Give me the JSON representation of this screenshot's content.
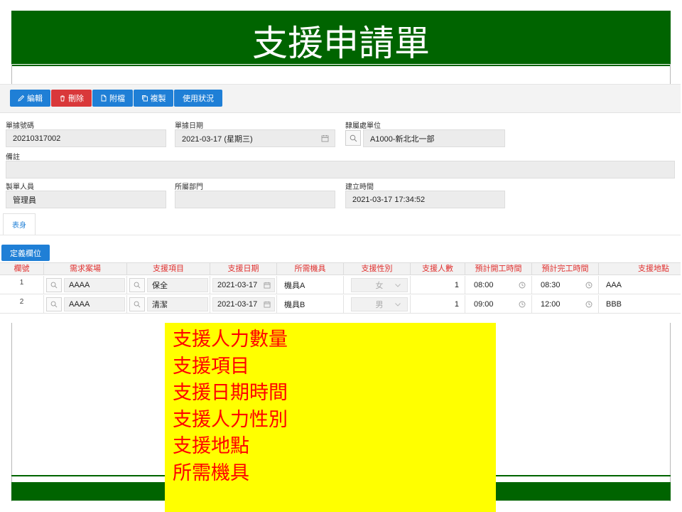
{
  "slide": {
    "title": "支援申請單"
  },
  "toolbar": {
    "buttons": [
      {
        "label": "編輯",
        "icon": "pencil-icon",
        "color": "#1f7fd6"
      },
      {
        "label": "刪除",
        "icon": "trash-icon",
        "color": "#d9383a"
      },
      {
        "label": "附檔",
        "icon": "file-icon",
        "color": "#1f7fd6"
      },
      {
        "label": "複製",
        "icon": "copy-icon",
        "color": "#1f7fd6"
      },
      {
        "label": "使用狀況",
        "icon": "",
        "color": "#1f7fd6"
      }
    ]
  },
  "form": {
    "doc_no": {
      "label": "單據號碼",
      "value": "20210317002"
    },
    "doc_date": {
      "label": "單據日期",
      "value": "2021-03-17 (星期三)"
    },
    "unit": {
      "label": "隸屬處單位",
      "value": "A1000-新北北一部"
    },
    "note": {
      "label": "備註",
      "value": ""
    },
    "creator": {
      "label": "製單人員",
      "value": "管理員"
    },
    "dept": {
      "label": "所屬部門",
      "value": ""
    },
    "created_at": {
      "label": "建立時間",
      "value": "2021-03-17 17:34:52"
    }
  },
  "tabs": {
    "body": "表身"
  },
  "grid": {
    "define_columns_label": "定義欄位",
    "headers": [
      "欄號",
      "需求案場",
      "支援項目",
      "支援日期",
      "所需機具",
      "支援性別",
      "支援人數",
      "預計開工時間",
      "預計完工時間",
      "支援地點"
    ],
    "rows": [
      {
        "no": "1",
        "site": "AAAA",
        "item": "保全",
        "date": "2021-03-17",
        "tool": "機具A",
        "gender": "女",
        "count": "1",
        "start": "08:00",
        "end": "08:30",
        "place": "AAA"
      },
      {
        "no": "2",
        "site": "AAAA",
        "item": "清潔",
        "date": "2021-03-17",
        "tool": "機具B",
        "gender": "男",
        "count": "1",
        "start": "09:00",
        "end": "12:00",
        "place": "BBB"
      }
    ]
  },
  "callout": {
    "lines": [
      "支援人力數量",
      "支援項目",
      "支援日期時間",
      "支援人力性別",
      "支援地點",
      "所需機具"
    ]
  },
  "colors": {
    "header_green": "#006400",
    "accent_blue": "#1f7fd6",
    "delete_red": "#d9383a",
    "header_text_red": "#e0302e",
    "callout_yellow": "#ffff00",
    "callout_text": "#ff0000"
  }
}
